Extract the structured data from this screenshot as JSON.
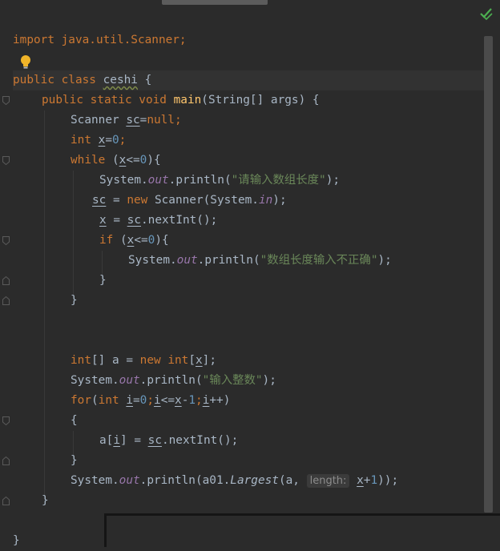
{
  "editor": {
    "lines": {
      "l0": "import java.util.Scanner;",
      "l1_kw": "public class ",
      "l1_name": "ceshi",
      "l1_rest": " {",
      "l2_kw": "public static void ",
      "l2_fn": "main",
      "l2_rest": "(String[] args) {",
      "l3_a": "Scanner ",
      "l3_var": "sc",
      "l3_eq": "=",
      "l3_null": "null",
      "l3_semi": ";",
      "l4_kw": "int ",
      "l4_var": "x",
      "l4_eq": "=",
      "l4_num": "0",
      "l4_semi": ";",
      "l5_kw": "while",
      "l5_a": " (",
      "l5_var": "x",
      "l5_b": "<=",
      "l5_num": "0",
      "l5_c": "){",
      "l6_a": "System.",
      "l6_fld": "out",
      "l6_b": ".println(",
      "l6_str": "\"请输入数组长度\"",
      "l6_c": ");",
      "l7_var": "sc",
      "l7_a": " = ",
      "l7_kw": "new ",
      "l7_b": "Scanner(System.",
      "l7_fld": "in",
      "l7_c": ");",
      "l8_var": "x",
      "l8_a": " = ",
      "l8_var2": "sc",
      "l8_b": ".nextInt();",
      "l9_kw": "if",
      "l9_a": " (",
      "l9_var": "x",
      "l9_b": "<=",
      "l9_num": "0",
      "l9_c": "){",
      "l10_a": "System.",
      "l10_fld": "out",
      "l10_b": ".println(",
      "l10_str": "\"数组长度输入不正确\"",
      "l10_c": ");",
      "l11": "}",
      "l12": "}",
      "l13_kw": "int",
      "l13_a": "[] a = ",
      "l13_kw2": "new ",
      "l13_kw3": "int",
      "l13_b": "[",
      "l13_var": "x",
      "l13_c": "];",
      "l14_a": "System.",
      "l14_fld": "out",
      "l14_b": ".println(",
      "l14_str": "\"输入整数\"",
      "l14_c": ");",
      "l15_kw": "for",
      "l15_a": "(",
      "l15_kw2": "int ",
      "l15_v1": "i",
      "l15_b": "=",
      "l15_n0": "0",
      "l15_c": ";",
      "l15_v2": "i",
      "l15_d": "<=",
      "l15_v3": "x",
      "l15_e": "-",
      "l15_n1": "1",
      "l15_f": ";",
      "l15_v4": "i",
      "l15_g": "++)",
      "l16": "{",
      "l17_a": "a[",
      "l17_var": "i",
      "l17_b": "] = ",
      "l17_var2": "sc",
      "l17_c": ".nextInt();",
      "l18": "}",
      "l19_a": "System.",
      "l19_fld": "out",
      "l19_b": ".println(a01.",
      "l19_m": "Largest",
      "l19_c": "(a, ",
      "l19_hint": "length:",
      "l19_var": "x",
      "l19_op": "+",
      "l19_num": "1",
      "l19_d": "));",
      "l20": "}",
      "l21": "}"
    }
  },
  "colors": {
    "background": "#2b2b2b",
    "keyword": "#cc7832",
    "string": "#6a8759",
    "number": "#6897bb",
    "field": "#9876aa",
    "method": "#ffc66d"
  },
  "icons": [
    "bulb-icon",
    "inspection-ok-icon",
    "fold-icon"
  ]
}
